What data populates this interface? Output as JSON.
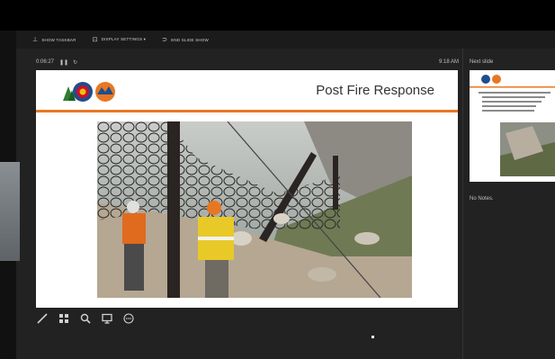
{
  "toolbar": {
    "items": [
      {
        "icon": "presenter-icon",
        "label": "SHOW TASKBAR"
      },
      {
        "icon": "display-settings-icon",
        "label": "DISPLAY SETTINGS ▾"
      },
      {
        "icon": "end-show-icon",
        "label": "END SLIDE SHOW"
      }
    ]
  },
  "timer": {
    "elapsed": "0:06:27",
    "clock": "9:18 AM"
  },
  "slide": {
    "title": "Post Fire Response"
  },
  "next_slide": {
    "label": "Next slide"
  },
  "notes": {
    "text": "No Notes."
  },
  "colors": {
    "accent_orange": "#e87722",
    "logo_blue": "#1f4e8c",
    "logo_red": "#c8102e"
  },
  "tools": [
    "pen-icon",
    "slides-grid-icon",
    "zoom-icon",
    "screen-icon",
    "more-icon"
  ]
}
